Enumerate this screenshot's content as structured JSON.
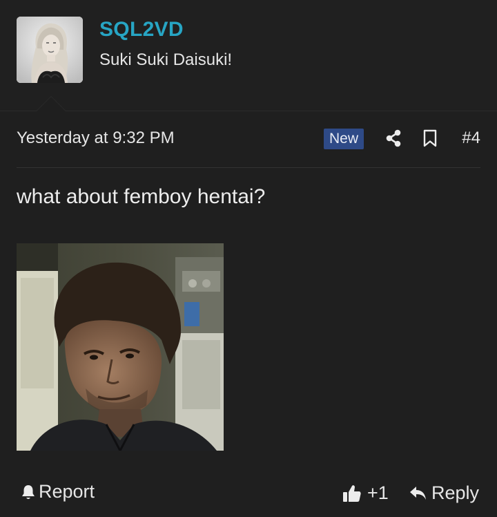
{
  "user": {
    "name": "SQL2VD",
    "title": "Suki Suki Daisuki!",
    "avatar_icon": "user-avatar-photo",
    "name_color": "#27a5c4"
  },
  "meta": {
    "timestamp": "Yesterday at 9:32 PM",
    "badge": "New",
    "badge_color": "#2e4a87",
    "share_icon": "share-icon",
    "bookmark_icon": "bookmark-icon",
    "post_number": "#4"
  },
  "post": {
    "text": "what about femboy hentai?",
    "image_icon": "post-gif-image"
  },
  "actions": {
    "report_label": "Report",
    "like_count": "+1",
    "reply_label": "Reply"
  }
}
